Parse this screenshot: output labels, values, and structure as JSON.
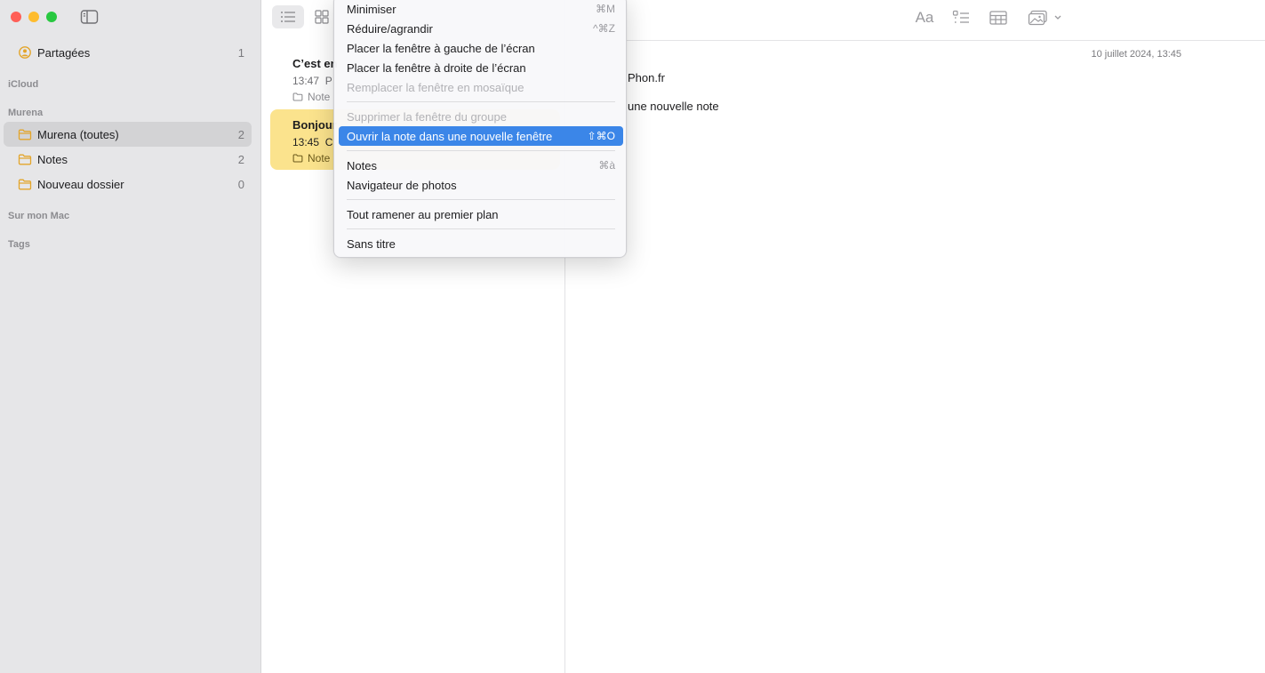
{
  "sidebar": {
    "shared": {
      "label": "Partagées",
      "count": "1"
    },
    "sections": {
      "icloud": "iCloud",
      "murena": "Murena",
      "mac": "Sur mon Mac",
      "tags": "Tags"
    },
    "folders": [
      {
        "label": "Murena (toutes)",
        "count": "2",
        "active": true
      },
      {
        "label": "Notes",
        "count": "2",
        "active": false
      },
      {
        "label": "Nouveau dossier",
        "count": "0",
        "active": false
      }
    ]
  },
  "notes": [
    {
      "title": "C’est en",
      "time": "13:47",
      "preview": "P",
      "folder": "Note",
      "selected": false
    },
    {
      "title": "Bonjour",
      "time": "13:45",
      "preview": "C",
      "folder": "Note",
      "selected": true
    }
  ],
  "editor": {
    "date": "10 juillet 2024, 13:45",
    "line1": "Phon.fr",
    "line2": "une nouvelle note",
    "format_label": "Aa"
  },
  "menu": {
    "items": [
      {
        "label": "Minimiser",
        "shortcut": "⌘M",
        "disabled": false,
        "highlight": false
      },
      {
        "label": "Réduire/agrandir",
        "shortcut": "^⌘Z",
        "disabled": false,
        "highlight": false
      },
      {
        "label": "Placer la fenêtre à gauche de l’écran",
        "shortcut": "",
        "disabled": false,
        "highlight": false
      },
      {
        "label": "Placer la fenêtre à droite de l’écran",
        "shortcut": "",
        "disabled": false,
        "highlight": false
      },
      {
        "label": "Remplacer la fenêtre en mosaïque",
        "shortcut": "",
        "disabled": true,
        "highlight": false
      },
      {
        "label": "Supprimer la fenêtre du groupe",
        "shortcut": "",
        "disabled": true,
        "highlight": false
      },
      {
        "label": "Ouvrir la note dans une nouvelle fenêtre",
        "shortcut": "⇧⌘O",
        "disabled": false,
        "highlight": true
      },
      {
        "label": "Notes",
        "shortcut": "⌘à",
        "disabled": false,
        "highlight": false
      },
      {
        "label": "Navigateur de photos",
        "shortcut": "",
        "disabled": false,
        "highlight": false
      },
      {
        "label": "Tout ramener au premier plan",
        "shortcut": "",
        "disabled": false,
        "highlight": false
      },
      {
        "label": "Sans titre",
        "shortcut": "",
        "disabled": false,
        "highlight": false
      }
    ]
  },
  "colors": {
    "accent": "#3b86e8",
    "folder_icon": "#e3a52a",
    "selected_note": "#fbe38d"
  }
}
